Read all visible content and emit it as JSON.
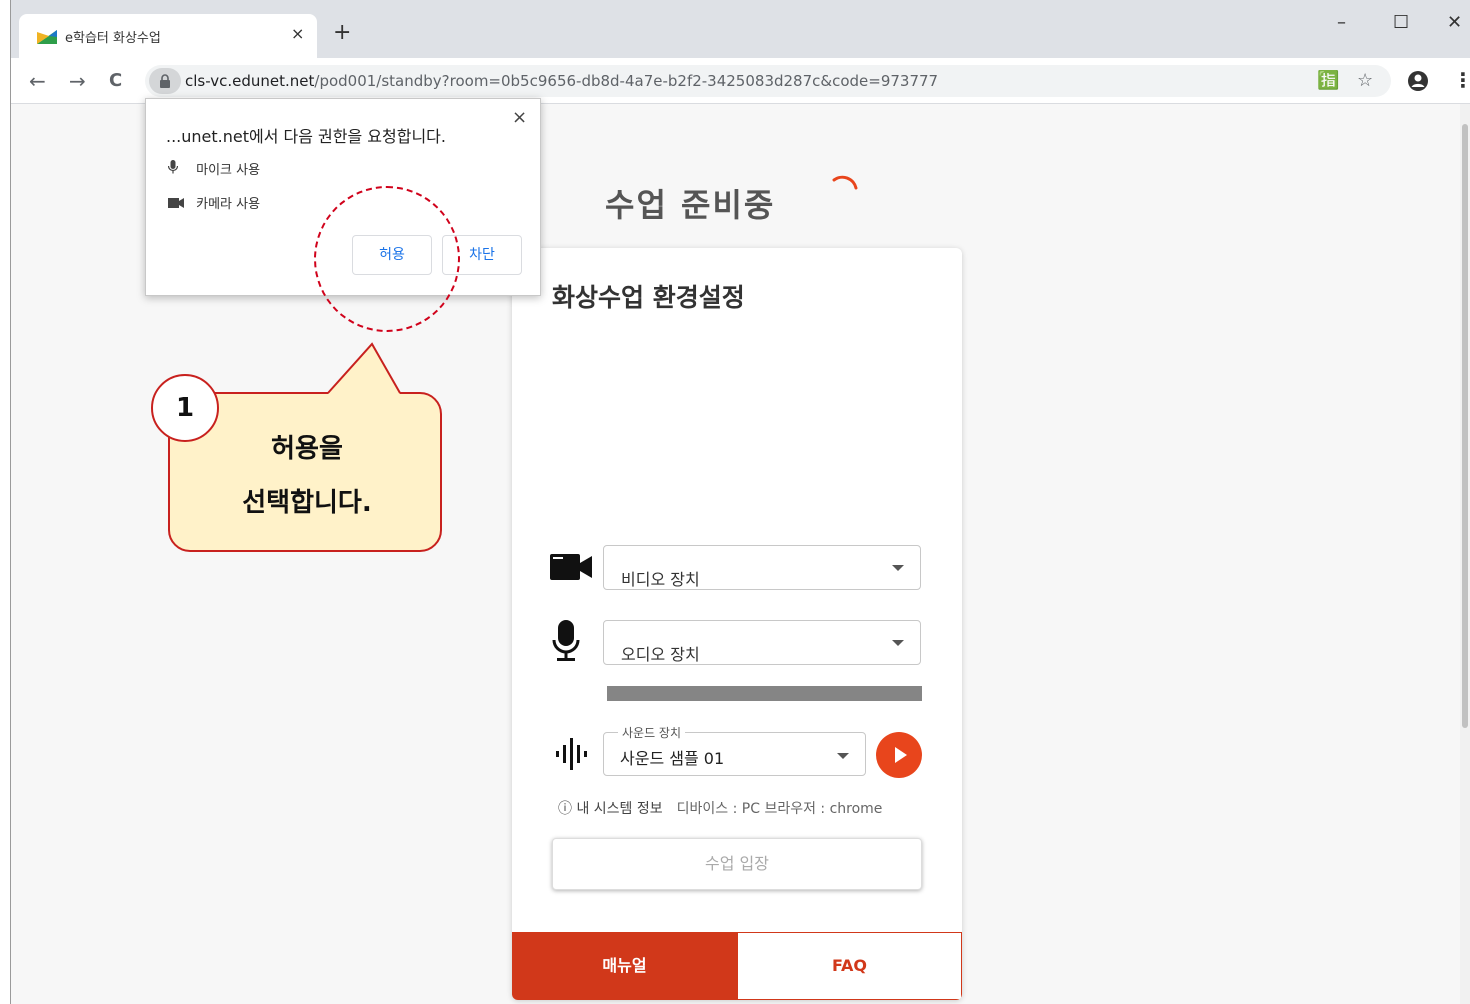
{
  "browser": {
    "tab_title": "e학습터 화상수업",
    "tab_close": "×",
    "new_tab": "+",
    "window_controls": {
      "minimize": "–",
      "maximize": "☐",
      "close": "✕"
    },
    "url_host": "cls-vc.edunet.net",
    "url_path": "/pod001/standby?room=0b5c9656-db8d-4a7e-b2f2-3425083d287c&code=973777",
    "nav": {
      "back": "←",
      "forward": "→",
      "reload": "C"
    },
    "toolbar_icons": {
      "translate": "🈯",
      "star": "☆",
      "menu": "⋮"
    }
  },
  "permission_popup": {
    "title": "...unet.net에서 다음 권한을 요청합니다.",
    "close": "×",
    "items": [
      {
        "icon": "microphone-icon",
        "label": "마이크 사용"
      },
      {
        "icon": "camera-icon",
        "label": "카메라 사용"
      }
    ],
    "allow_label": "허용",
    "block_label": "차단"
  },
  "page": {
    "title": "수업 준비중",
    "card_title": "화상수업 환경설정",
    "video_device": "비디오 장치",
    "audio_device": "오디오 장치",
    "sound_device_legend": "사운드 장치",
    "sound_sample": "사운드 샘플 01",
    "sysinfo_label": "ⓘ 내 시스템 정보",
    "sysinfo_detail": "디바이스 : PC 브라우저 : chrome",
    "enter_button": "수업 입장",
    "manual_tab": "매뉴얼",
    "faq_tab": "FAQ"
  },
  "annotation": {
    "step_number": "1",
    "line1": "허용을",
    "line2": "선택합니다."
  },
  "colors": {
    "accent": "#d1381a",
    "play": "#e8451c",
    "callout_fill": "#fff2c9",
    "callout_border": "#c8211e"
  }
}
